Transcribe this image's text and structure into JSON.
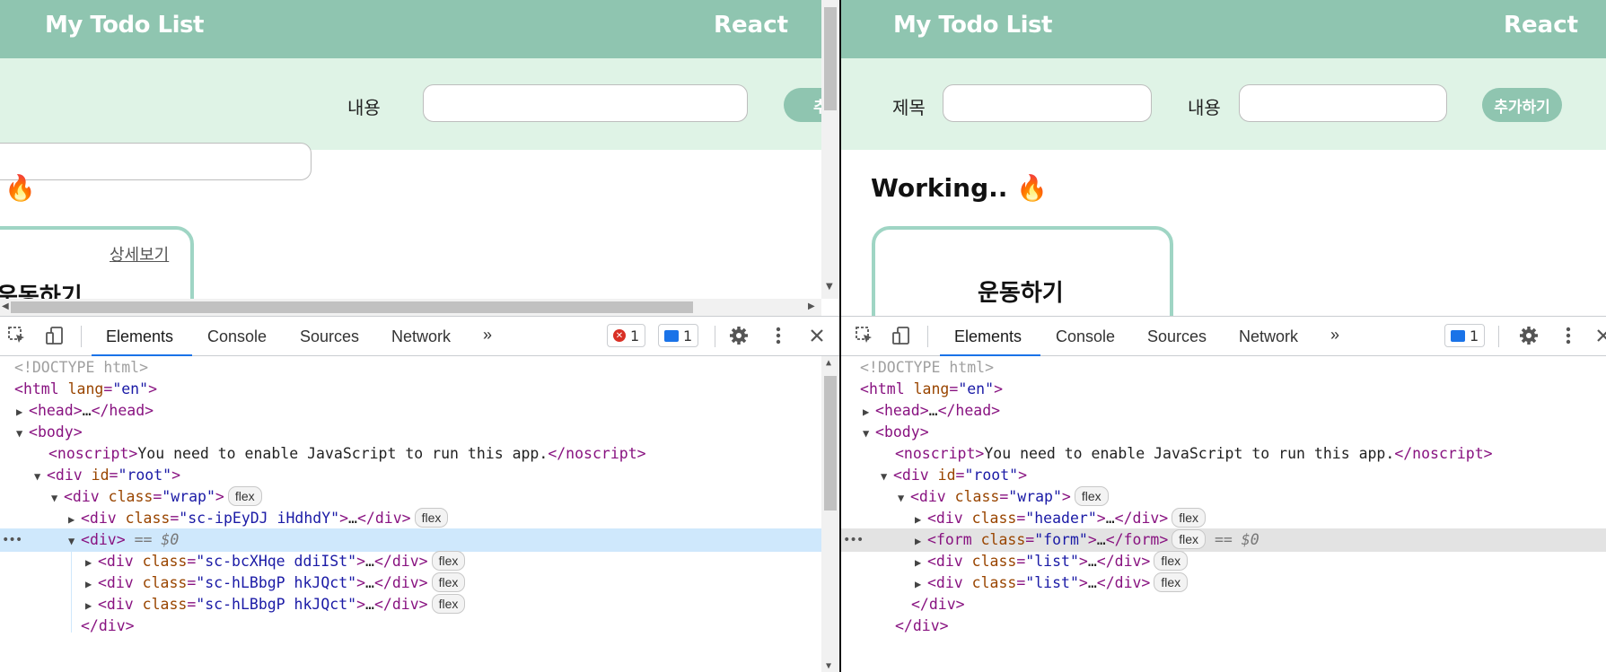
{
  "left": {
    "app": {
      "title": "My Todo List",
      "brand": "React",
      "content_label": "내용",
      "add_button": "추",
      "section_title": "🔥",
      "card_detail": "상세보기",
      "card_title": "운동하기"
    },
    "devtools": {
      "tabs": [
        "Elements",
        "Console",
        "Sources",
        "Network"
      ],
      "more": "»",
      "error_count": "1",
      "message_count": "1",
      "tree": {
        "doctype": "<!DOCTYPE html>",
        "html_tag": "html",
        "lang_attr": "lang",
        "lang_val": "\"en\"",
        "head": "head",
        "head_ellipsis": "…",
        "body": "body",
        "noscript_text": "You need to enable JavaScript to run this app.",
        "root_attr": "id",
        "root_val": "\"root\"",
        "wrap_attr": "class",
        "wrap_val": "\"wrap\"",
        "child1_val": "\"sc-ipEyDJ iHdhdY\"",
        "selected_tag": "div",
        "selected_suffix": "== $0",
        "child2_val": "\"sc-bcXHqe ddiISt\"",
        "child3_val": "\"sc-hLBbgP hkJQct\"",
        "child4_val": "\"sc-hLBbgP hkJQct\"",
        "closing": "</div>",
        "flex": "flex"
      }
    }
  },
  "right": {
    "app": {
      "title": "My Todo List",
      "brand": "React",
      "title_label": "제목",
      "content_label": "내용",
      "add_button": "추가하기",
      "section_title": "Working.. 🔥",
      "card_title": "운동하기"
    },
    "devtools": {
      "tabs": [
        "Elements",
        "Console",
        "Sources",
        "Network"
      ],
      "more": "»",
      "message_count": "1",
      "tree": {
        "header_val": "\"header\"",
        "form_tag": "form",
        "form_val": "\"form\"",
        "list_val": "\"list\"",
        "selected_suffix": "== $0",
        "closing": "</div>"
      }
    }
  }
}
